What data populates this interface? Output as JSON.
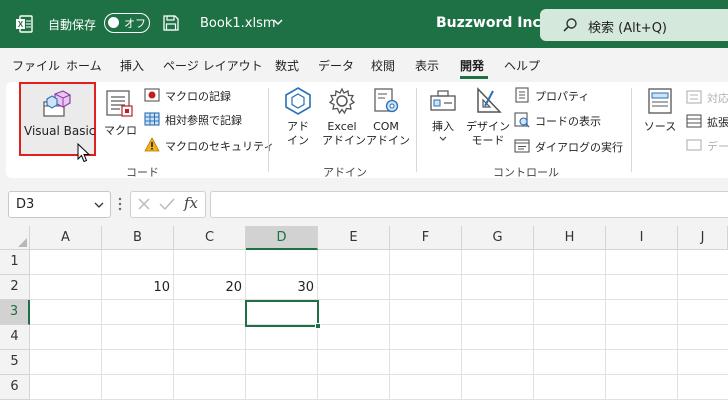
{
  "titlebar": {
    "autosave_label": "自動保存",
    "autosave_state": "オフ",
    "filename": "Book1.xlsm",
    "company": "Buzzword Inc.",
    "search_text": "検索 (Alt+Q)"
  },
  "menu": {
    "items": [
      "ファイル",
      "ホーム",
      "挿入",
      "ページ レイアウト",
      "数式",
      "データ",
      "校閲",
      "表示",
      "開発",
      "ヘルプ"
    ],
    "active": "開発"
  },
  "ribbon": {
    "code": {
      "visual_basic": "Visual Basic",
      "macro": "マクロ",
      "record_macro": "マクロの記録",
      "relative_ref": "相対参照で記録",
      "macro_security": "マクロのセキュリティ",
      "group_label": "コード"
    },
    "addins": {
      "addin": "アド\nイン",
      "excel_addin": "Excel\nアドイン",
      "com_addin": "COM\nアドイン",
      "group_label": "アドイン"
    },
    "controls": {
      "insert": "挿入",
      "design_mode": "デザイン\nモード",
      "properties": "プロパティ",
      "view_code": "コードの表示",
      "run_dialog": "ダイアログの実行",
      "group_label": "コントロール"
    },
    "xml": {
      "source": "ソース",
      "map_props": "対応",
      "expand": "拡張",
      "data": "デー"
    }
  },
  "formula_bar": {
    "name_box": "D3",
    "fx": "fx",
    "formula": ""
  },
  "grid": {
    "columns": [
      "A",
      "B",
      "C",
      "D",
      "E",
      "F",
      "G",
      "H",
      "I",
      "J"
    ],
    "rows": [
      "1",
      "2",
      "3",
      "4",
      "5",
      "6"
    ],
    "selected_column": "D",
    "selected_row": "3",
    "cells": {
      "B2": "10",
      "C2": "20",
      "D2": "30"
    }
  },
  "colors": {
    "accent": "#1e7145",
    "highlight": "#e02020"
  }
}
